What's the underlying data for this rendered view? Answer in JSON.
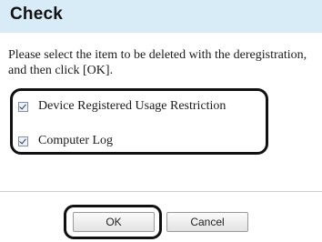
{
  "dialog": {
    "title": "Check",
    "message": "Please select the item to be deleted with the deregistration, and then click [OK].",
    "options": [
      {
        "label": "Device Registered Usage Restriction",
        "checked": true
      },
      {
        "label": "Computer Log",
        "checked": true
      }
    ],
    "buttons": {
      "ok_label": "OK",
      "cancel_label": "Cancel"
    }
  },
  "colors": {
    "title_bar_background": "#d8ecf8",
    "highlight_outline": "#111111"
  },
  "icons": {
    "checkbox": "checkmark-icon"
  }
}
